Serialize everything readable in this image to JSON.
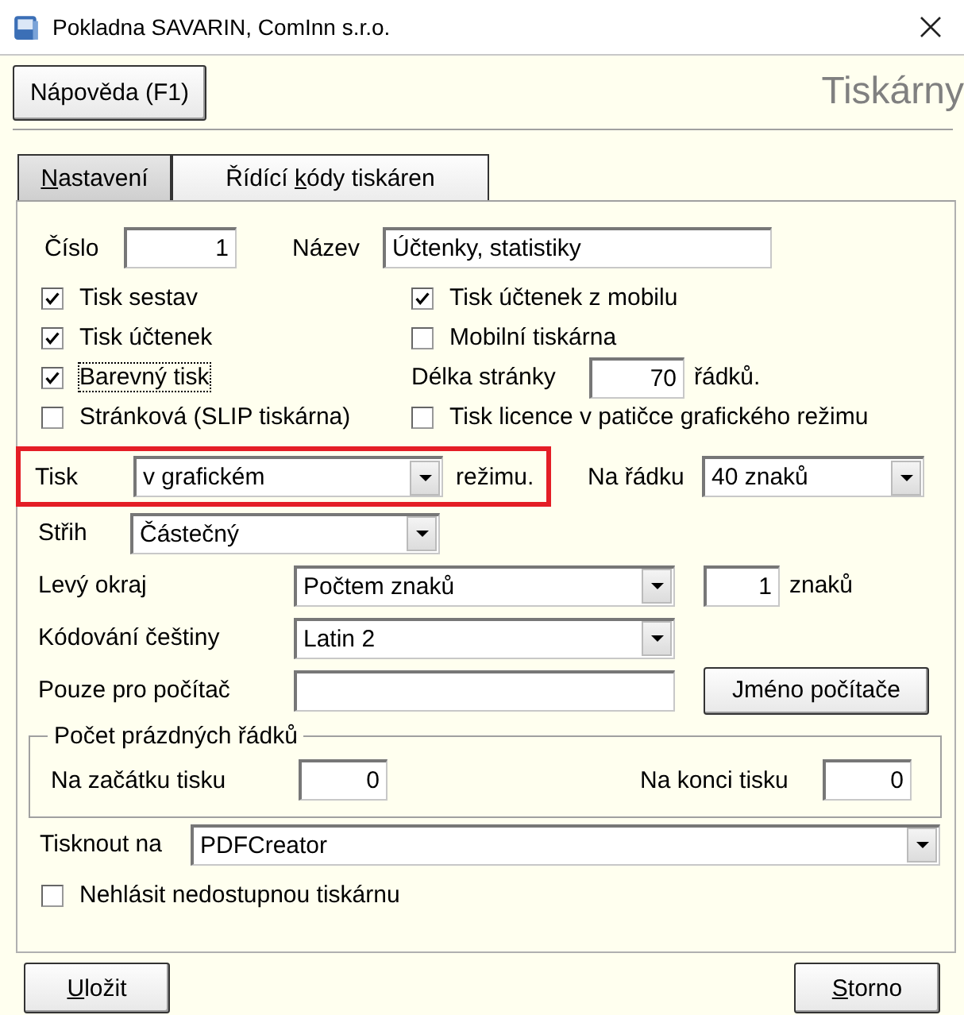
{
  "window": {
    "title": "Pokladna SAVARIN, ComInn s.r.o."
  },
  "toolbar": {
    "help_button": {
      "after": "Nápověda (F1)"
    },
    "page_title": "Tiskárny"
  },
  "tabs": [
    {
      "key": "N",
      "after": "astavení",
      "selected": true
    },
    {
      "before": "Řídící ",
      "key": "k",
      "after": "ódy tiskáren",
      "selected": false
    }
  ],
  "number": {
    "label": "Číslo",
    "value": "1"
  },
  "name": {
    "label": "Název",
    "value": "Účtenky, statistiky"
  },
  "left_options": [
    {
      "kind": "checkbox",
      "label": "Tisk sestav",
      "checked": true,
      "focused": false
    },
    {
      "kind": "checkbox",
      "label": "Tisk účtenek",
      "checked": true,
      "focused": false
    },
    {
      "kind": "checkbox",
      "label": "Barevný tisk",
      "checked": true,
      "focused": true
    },
    {
      "kind": "checkbox",
      "label": "Stránková (SLIP tiskárna)",
      "checked": false,
      "focused": false
    }
  ],
  "right_options": [
    {
      "kind": "checkbox",
      "label": "Tisk účtenek z mobilu",
      "checked": true,
      "focused": false
    },
    {
      "kind": "checkbox",
      "label": "Mobilní tiskárna",
      "checked": false,
      "focused": false
    },
    {
      "kind": "number_field",
      "label": "Délka stránky",
      "value": "70",
      "unit": "řádků."
    },
    {
      "kind": "checkbox",
      "label": "Tisk licence v patičce grafického režimu",
      "checked": false,
      "focused": false
    }
  ],
  "print_mode": {
    "label": "Tisk",
    "value": "v grafickém",
    "suffix": "režimu.",
    "highlighted": true
  },
  "per_line": {
    "label": "Na řádku",
    "value": "40 znaků"
  },
  "cut": {
    "label": "Střih",
    "value": "Částečný"
  },
  "left_margin": {
    "label": "Levý okraj",
    "value": "Počtem znaků",
    "count": "1",
    "unit": "znaků"
  },
  "encoding": {
    "label": "Kódování češtiny",
    "value": "Latin 2"
  },
  "computer_only": {
    "label": "Pouze pro počítač",
    "button": "Jméno počítače"
  },
  "blank_lines": {
    "title": "Počet prázdných řádků",
    "start": {
      "label": "Na začátku tisku",
      "value": "0"
    },
    "end": {
      "label": "Na konci tisku",
      "value": "0"
    }
  },
  "print_to": {
    "label": "Tisknout na",
    "value": "PDFCreator"
  },
  "unavailable": {
    "label": "Nehlásit nedostupnou tiskárnu",
    "checked": false
  },
  "footer_buttons": [
    {
      "key": "U",
      "after": "ložit"
    },
    {
      "key": "S",
      "after": "torno"
    }
  ]
}
